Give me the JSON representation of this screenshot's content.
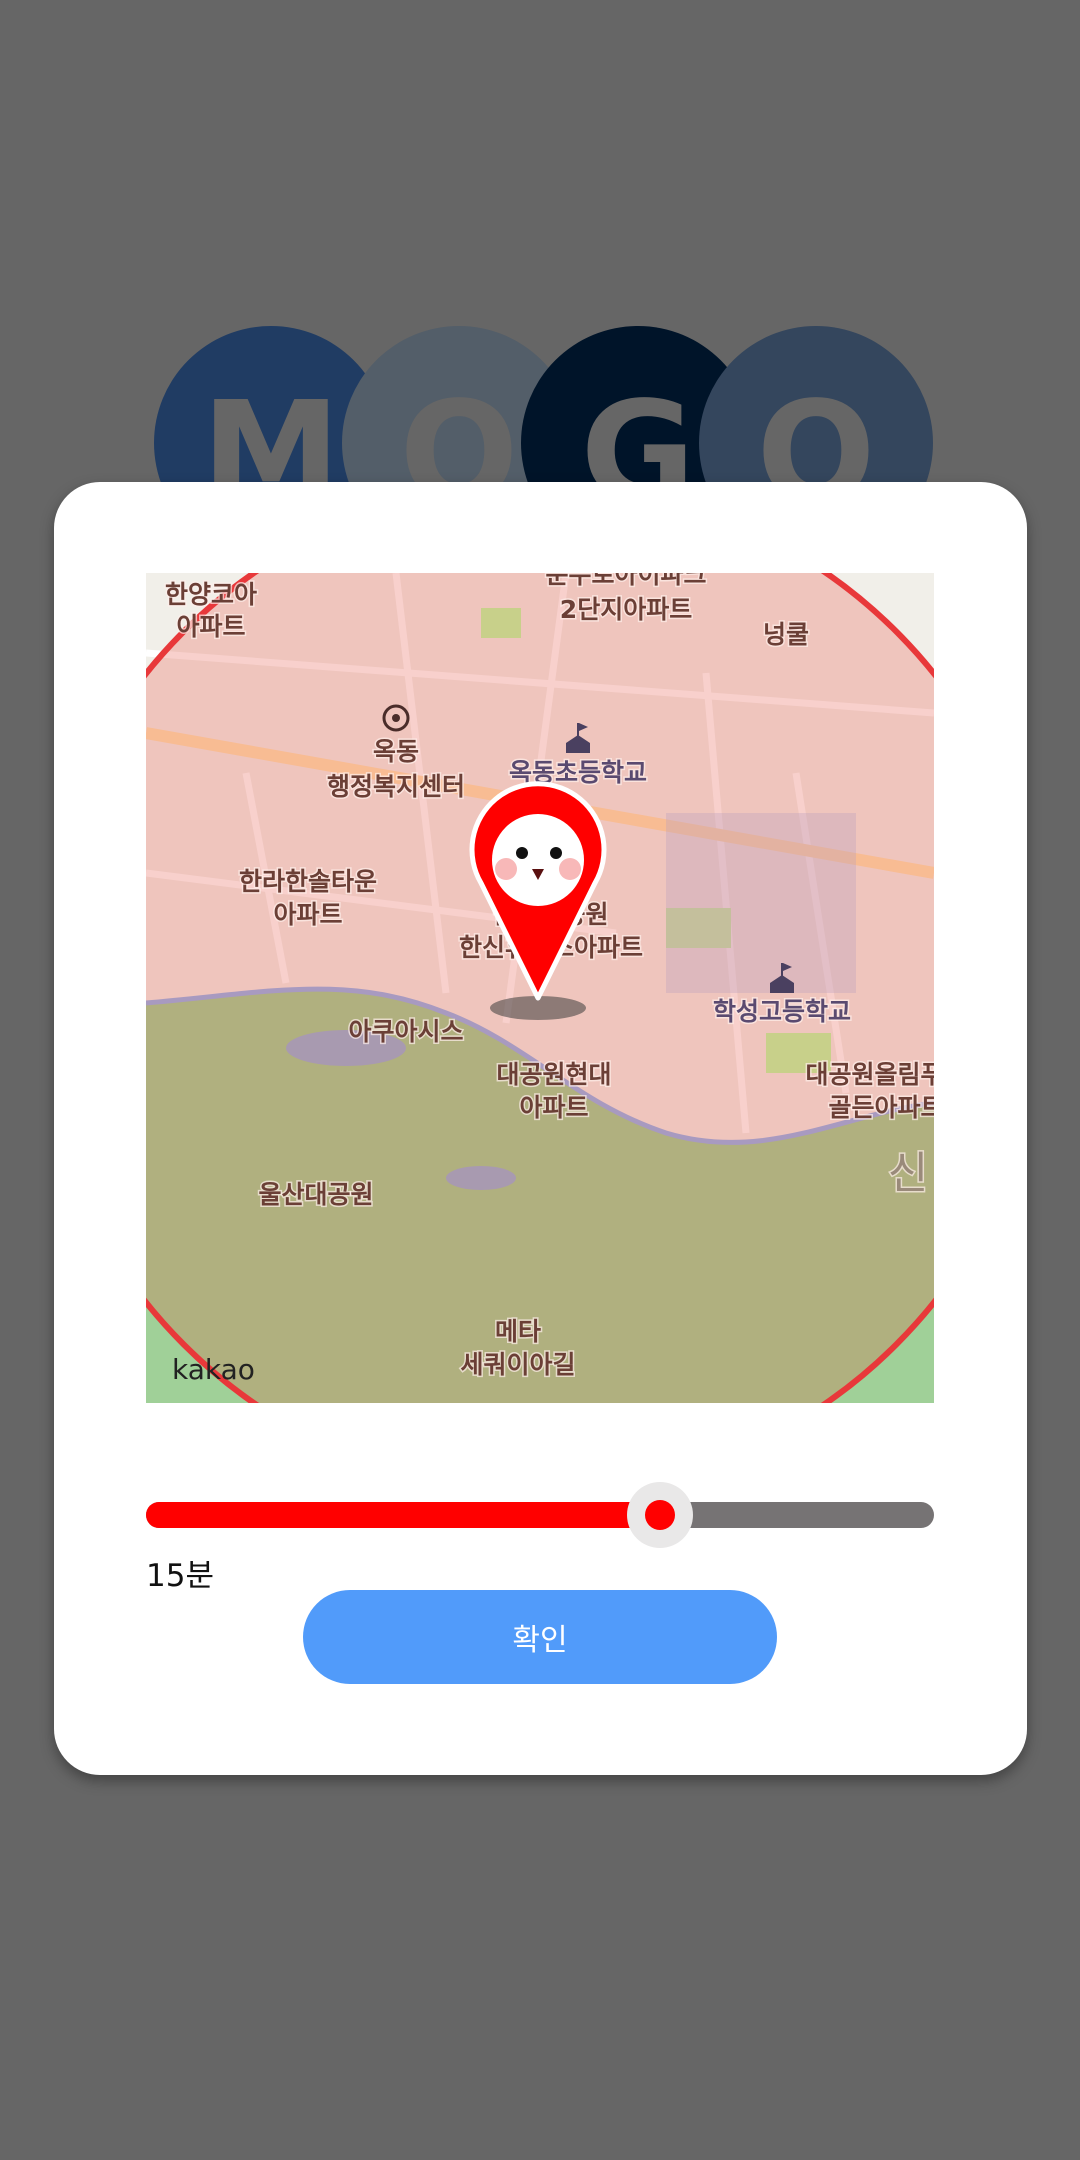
{
  "logo": {
    "letters": [
      "M",
      "O",
      "G",
      "O"
    ],
    "colors": [
      "#203c63",
      "#535e69",
      "#001429",
      "#34465d"
    ]
  },
  "map": {
    "attribution": "kakao",
    "labels": {
      "hanyang1": "한양코아",
      "hanyang2": "아파트",
      "bunsu1": "분수로아이파크",
      "bunsu2": "2단지아파트",
      "nungul": "넝쿨",
      "okdong1": "옥동",
      "okdong2": "행정복지센터",
      "okdong_school": "옥동초등학교",
      "halla1": "한라한솔타운",
      "halla2": "아파트",
      "hanshin1": "울산대공원",
      "hanshin2": "한신휴먼스아파트",
      "aquasis": "아쿠아시스",
      "hyundai1": "대공원현대",
      "hyundai2": "아파트",
      "haksung": "학성고등학교",
      "olympus1": "대공원올림푸스",
      "olympus2": "골든아파트",
      "sin": "신",
      "park": "울산대공원",
      "meta1": "메타",
      "meta2": "세쿼이아길"
    },
    "radius_color": "#ff0000"
  },
  "slider": {
    "fraction": 0.652,
    "fill_color": "#ff0000",
    "track_color": "#767374"
  },
  "value_label": "15분",
  "confirm_label": "확인"
}
